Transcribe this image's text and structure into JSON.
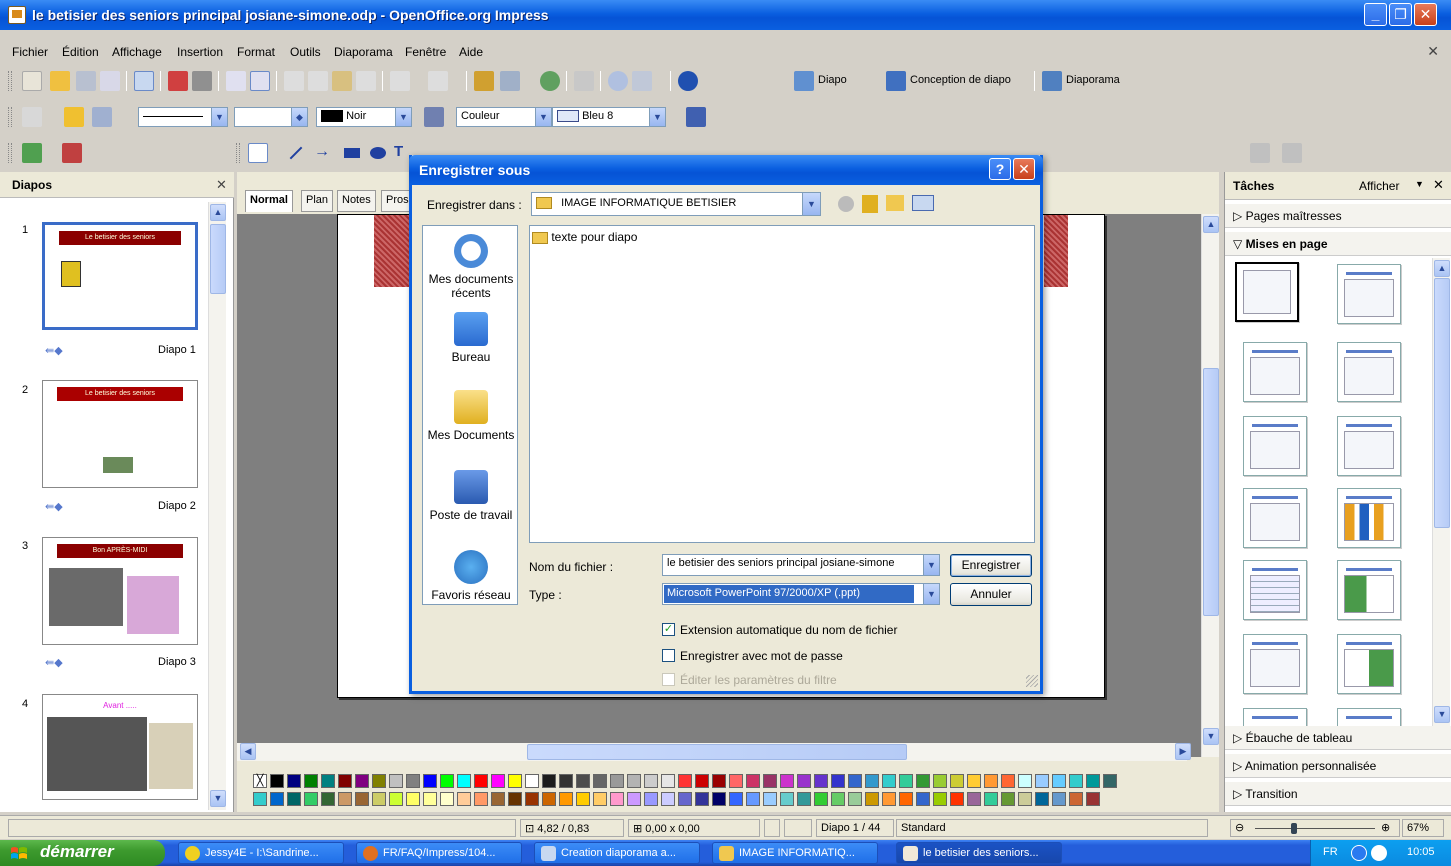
{
  "window": {
    "title": "le betisier des seniors principal josiane-simone.odp - OpenOffice.org Impress"
  },
  "menu": [
    "Fichier",
    "Édition",
    "Affichage",
    "Insertion",
    "Format",
    "Outils",
    "Diaporama",
    "Fenêtre",
    "Aide"
  ],
  "toolbar1": {
    "diapo_label": "Diapo",
    "conception_label": "Conception de diapo",
    "diaporama_label": "Diaporama"
  },
  "toolbar2": {
    "line_color": "Noir",
    "area_style": "Couleur",
    "area_color": "Bleu 8"
  },
  "slides_panel": {
    "title": "Diapos",
    "slides": [
      {
        "num": "1",
        "label": "Diapo 1",
        "banner": "Le betisier des seniors"
      },
      {
        "num": "2",
        "label": "Diapo 2",
        "banner": "Le betisier des seniors"
      },
      {
        "num": "3",
        "label": "Diapo 3",
        "banner": "Bon APRÈS-MIDI"
      },
      {
        "num": "4",
        "label": "",
        "banner": "Avant ....."
      }
    ]
  },
  "view_tabs": [
    "Normal",
    "Plan",
    "Notes",
    "Prospectus"
  ],
  "tasks_panel": {
    "title": "Tâches",
    "afficher": "Afficher",
    "sections": {
      "pages_maitresses": "Pages maîtresses",
      "mises_en_page": "Mises en page",
      "ebauche": "Ébauche de tableau",
      "animation": "Animation personnalisée",
      "transition": "Transition"
    }
  },
  "statusbar": {
    "position": "4,82 / 0,83",
    "size": "0,00 x 0,00",
    "slide": "Diapo 1 / 44",
    "style": "Standard",
    "zoom": "67%"
  },
  "dialog": {
    "title": "Enregistrer sous",
    "save_in_label": "Enregistrer dans :",
    "save_in_value": "IMAGE INFORMATIQUE BETISIER",
    "places": [
      "Mes documents récents",
      "Bureau",
      "Mes Documents",
      "Poste de travail",
      "Favoris réseau"
    ],
    "files": [
      "texte pour diapo"
    ],
    "filename_label": "Nom du fichier :",
    "filename_value": "le betisier des seniors principal josiane-simone",
    "type_label": "Type :",
    "type_value": "Microsoft PowerPoint 97/2000/XP (.ppt)",
    "save_button": "Enregistrer",
    "cancel_button": "Annuler",
    "opt_auto_ext": "Extension automatique du nom de fichier",
    "opt_password": "Enregistrer avec mot de passe",
    "opt_filter": "Éditer les paramètres du filtre"
  },
  "taskbar": {
    "start": "démarrer",
    "tasks": [
      "Jessy4E - I:\\Sandrine...",
      "FR/FAQ/Impress/104...",
      "Creation diaporama a...",
      "IMAGE INFORMATIQ...",
      "le betisier des seniors..."
    ],
    "lang": "FR",
    "clock": "10:05"
  }
}
